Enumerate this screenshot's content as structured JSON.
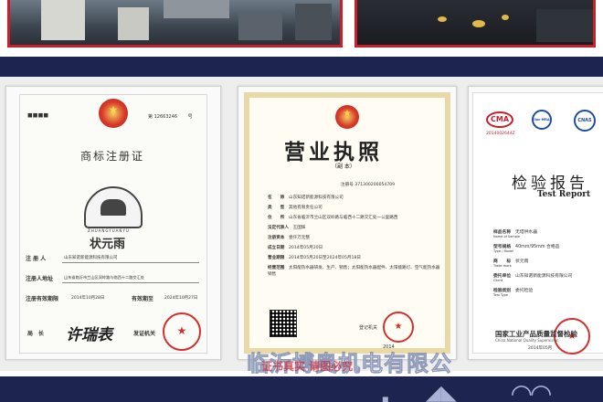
{
  "certificates": {
    "trademark": {
      "title": "商标注册证",
      "reg_no_label": "第",
      "reg_no": "12663246",
      "reg_no_suffix": "号",
      "brand_pinyin": "ZHUANGYUANYU",
      "brand_name": "状元雨",
      "registrant_label": "注 册 人",
      "registrant_value": "山东知诺新能源科技有限公司",
      "address_label": "注册人地址",
      "address_value": "山东省临沂市兰山区双岭路与临西十二路交汇处",
      "valid_label": "注册有效期限",
      "valid_value": "2014年10月28日",
      "valid_to": "2024年10月27日",
      "valid_end_label": "有效期至",
      "director_label": "局　长",
      "director_signature": "许瑞表",
      "issuer_label": "发证机关"
    },
    "license": {
      "title": "营业执照",
      "subtitle": "（副 本）",
      "reg_no_label": "注册号",
      "reg_no": "371300200054709",
      "rows": [
        {
          "label": "名　　称",
          "value": "山东知诺新能源科技有限公司"
        },
        {
          "label": "类　　型",
          "value": "其他有限责任公司"
        },
        {
          "label": "住　　所",
          "value": "山东省临沂市兰山区双岭路与临西十二路交汇处一公里路西"
        },
        {
          "label": "法定代表人",
          "value": "王国辉"
        },
        {
          "label": "注册资本",
          "value": "壹仟万元整"
        },
        {
          "label": "成立日期",
          "value": "2014年05月20日"
        },
        {
          "label": "营业期限",
          "value": "2014年05月20日至2024年05月18日"
        },
        {
          "label": "经营范围",
          "value": "太阳能热水器研发、生产、销售；太阳能热水器配件、太阳能路灯、空气能热水器销售"
        }
      ],
      "issuer_label": "登记机关",
      "year": "2014"
    },
    "report": {
      "badges": [
        "CMA",
        "ilac-MRA",
        "CNAS"
      ],
      "cma_no": "2014002644Z",
      "title_cn": "检验报告",
      "title_en": "Test Report",
      "rows": [
        {
          "label": "样品名称",
          "sub": "Name of Sample",
          "value": "无塔供水器"
        },
        {
          "label": "型号规格",
          "sub": "Type / Model",
          "value": "40mm/95mm 合格品"
        },
        {
          "label": "商　　标",
          "sub": "Trade mark",
          "value": "状元雨"
        },
        {
          "label": "委托单位",
          "sub": "Client",
          "value": "山东知诺新能源科技有限公司"
        },
        {
          "label": "检验类别",
          "sub": "Test Type",
          "value": "委托检验"
        }
      ],
      "authority_cn": "国家工业产品质量监督检验",
      "authority_en": "China National Quality Supervision",
      "date": "2014年05月"
    }
  },
  "watermark": "临沂博奥机电有限公",
  "overlay_caption": "证书真实 请图必究",
  "colors": {
    "navy": "#1d2450",
    "red_frame": "#c8202a"
  }
}
